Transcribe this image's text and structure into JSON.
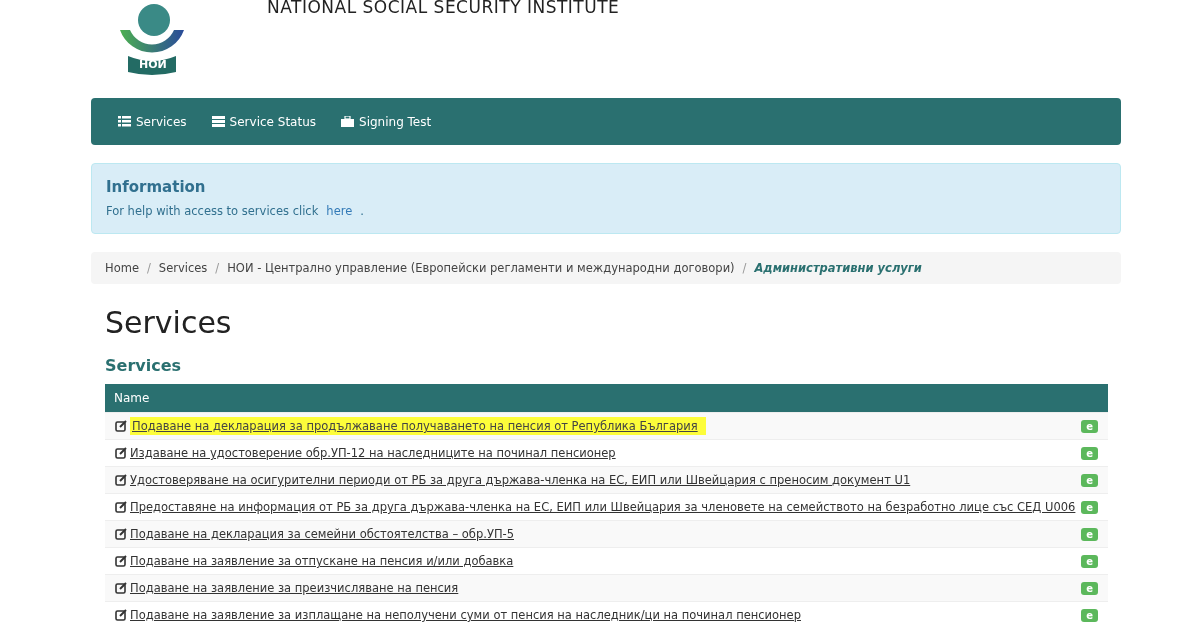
{
  "header": {
    "logo_text": "НОИ",
    "title": "NATIONAL SOCIAL SECURITY INSTITUTE"
  },
  "nav": [
    {
      "label": "Services",
      "kind": "list"
    },
    {
      "label": "Service Status",
      "kind": "status"
    },
    {
      "label": "Signing Test",
      "kind": "test"
    }
  ],
  "info": {
    "title": "Information",
    "text": "For help with access to services click",
    "link": "here",
    "end": "."
  },
  "breadcrumb_separator": "/",
  "breadcrumb": [
    {
      "label": "Home",
      "current": false
    },
    {
      "label": "Services",
      "current": false
    },
    {
      "label": "НОИ - Централно управление (Европейски регламенти и международни договори)",
      "current": false
    },
    {
      "label": "Административни услуги",
      "current": true
    }
  ],
  "page_title": "Services",
  "section_title": "Services",
  "table": {
    "columns": [
      "Name"
    ],
    "rows": [
      {
        "name": "Подаване на декларация за продължаване получаването на пенсия от Република България",
        "badge": "e",
        "highlighted": true
      },
      {
        "name": "Издаване на удостоверение обр.УП-12 на наследниците на починал пенсионер",
        "badge": "e",
        "highlighted": false
      },
      {
        "name": "Удостоверяване на осигурителни периоди от РБ за друга държава-членка на ЕС, ЕИП или Швейцария с преносим документ U1",
        "badge": "e",
        "highlighted": false
      },
      {
        "name": "Предоставяне на информация от РБ за друга държава-членка на ЕС, ЕИП или Швейцария за членовете на семейството на безработно лице със СЕД U006",
        "badge": "e",
        "highlighted": false
      },
      {
        "name": "Подаване на декларация за семейни обстоятелства – обр.УП-5",
        "badge": "e",
        "highlighted": false
      },
      {
        "name": "Подаване на заявление за отпускане на пенсия и/или добавка",
        "badge": "e",
        "highlighted": false
      },
      {
        "name": "Подаване на заявление за преизчисляване на пенсия",
        "badge": "e",
        "highlighted": false
      },
      {
        "name": "Подаване на заявление за изплащане на неполучени суми от пенсия на наследник/ци на починал пенсионер",
        "badge": "e",
        "highlighted": false
      }
    ]
  }
}
